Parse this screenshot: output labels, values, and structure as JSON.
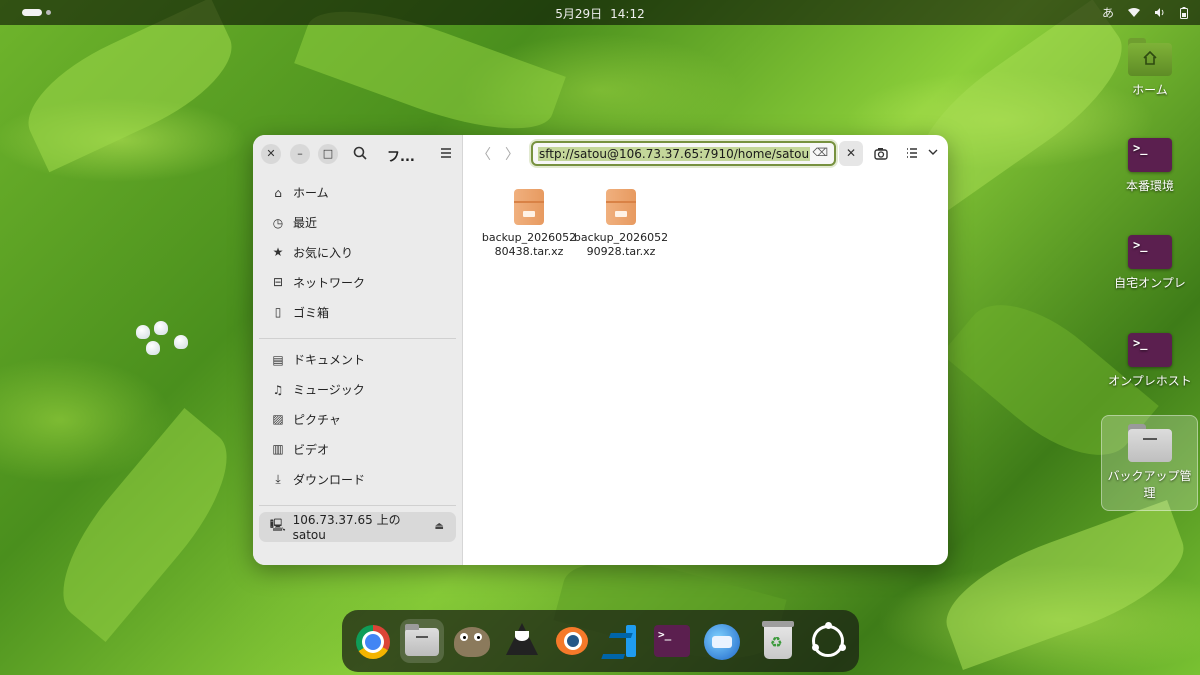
{
  "topbar": {
    "date": "5月29日",
    "time": "14:12",
    "ime": "あ"
  },
  "desktop_icons": [
    {
      "label": "ホーム",
      "icon": "home-folder-icon"
    },
    {
      "label": "本番環境",
      "icon": "terminal-icon"
    },
    {
      "label": "自宅オンプレ",
      "icon": "terminal-icon"
    },
    {
      "label": "オンプレホスト",
      "icon": "terminal-icon"
    },
    {
      "label": "バックアップ管理",
      "icon": "folder-icon"
    }
  ],
  "window": {
    "title": "フ...",
    "location": "sftp://satou@106.73.37.65:7910/home/satou",
    "sidebar": {
      "places": [
        {
          "label": "ホーム",
          "icon": "home-icon"
        },
        {
          "label": "最近",
          "icon": "clock-icon"
        },
        {
          "label": "お気に入り",
          "icon": "star-icon"
        },
        {
          "label": "ネットワーク",
          "icon": "network-icon"
        },
        {
          "label": "ゴミ箱",
          "icon": "trash-icon"
        }
      ],
      "folders": [
        {
          "label": "ドキュメント",
          "icon": "document-icon"
        },
        {
          "label": "ミュージック",
          "icon": "music-icon"
        },
        {
          "label": "ピクチャ",
          "icon": "picture-icon"
        },
        {
          "label": "ビデオ",
          "icon": "video-icon"
        },
        {
          "label": "ダウンロード",
          "icon": "download-icon"
        }
      ],
      "mounts": [
        {
          "label": "106.73.37.65 上の satou",
          "icon": "computer-icon"
        }
      ]
    },
    "files": [
      {
        "name": "backup_202605280438.tar.xz",
        "icon": "archive-icon"
      },
      {
        "name": "backup_202605290928.tar.xz",
        "icon": "archive-icon"
      }
    ]
  },
  "dock": [
    {
      "app": "Google Chrome",
      "icon": "chrome-icon"
    },
    {
      "app": "Files",
      "icon": "files-icon"
    },
    {
      "app": "GIMP",
      "icon": "gimp-icon"
    },
    {
      "app": "Inkscape",
      "icon": "inkscape-icon"
    },
    {
      "app": "Blender",
      "icon": "blender-icon"
    },
    {
      "app": "Visual Studio Code",
      "icon": "vscode-icon"
    },
    {
      "app": "Terminal",
      "icon": "terminal-icon"
    },
    {
      "app": "Thunderbird",
      "icon": "thunderbird-icon"
    },
    {
      "app": "Trash",
      "icon": "trash-icon"
    },
    {
      "app": "Show Apps",
      "icon": "ubuntu-icon"
    }
  ]
}
